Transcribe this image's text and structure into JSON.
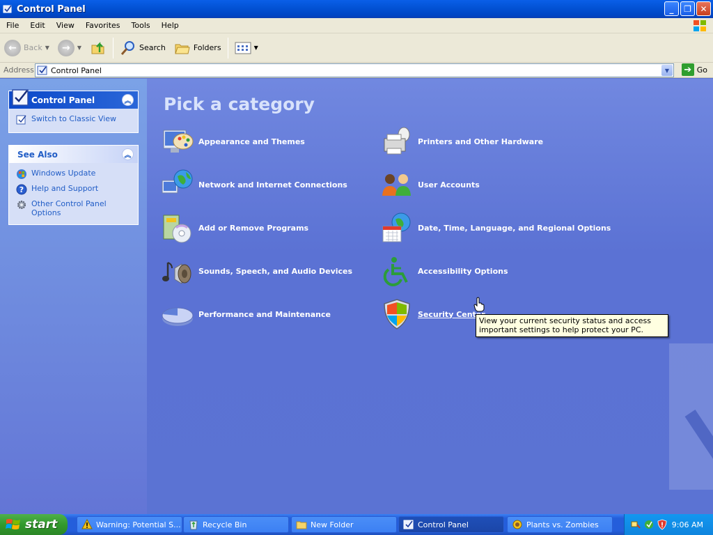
{
  "window": {
    "title": "Control Panel"
  },
  "menu": [
    "File",
    "Edit",
    "View",
    "Favorites",
    "Tools",
    "Help"
  ],
  "toolbar": {
    "back": "Back",
    "search": "Search",
    "folders": "Folders"
  },
  "address": {
    "label": "Address",
    "value": "Control Panel",
    "go": "Go"
  },
  "sidebar": {
    "control_panel": {
      "title": "Control Panel",
      "switch_link": "Switch to Classic View"
    },
    "see_also": {
      "title": "See Also",
      "items": [
        "Windows Update",
        "Help and Support",
        "Other Control Panel Options"
      ]
    }
  },
  "main": {
    "heading": "Pick a category",
    "categories": [
      "Appearance and Themes",
      "Printers and Other Hardware",
      "Network and Internet Connections",
      "User Accounts",
      "Add or Remove Programs",
      "Date, Time, Language, and Regional Options",
      "Sounds, Speech, and Audio Devices",
      "Accessibility Options",
      "Performance and Maintenance",
      "Security Center"
    ],
    "tooltip": "View your current security status and access important settings to help protect your PC."
  },
  "taskbar": {
    "start": "start",
    "tasks": [
      "Warning: Potential S...",
      "Recycle Bin",
      "New Folder",
      "Control Panel",
      "Plants vs. Zombies"
    ],
    "clock": "9:06 AM"
  },
  "colors": {
    "title_bar": "#0353d6",
    "pane_bg": "#5d74d6",
    "link": "#215dc6",
    "start_green": "#329a2c"
  }
}
